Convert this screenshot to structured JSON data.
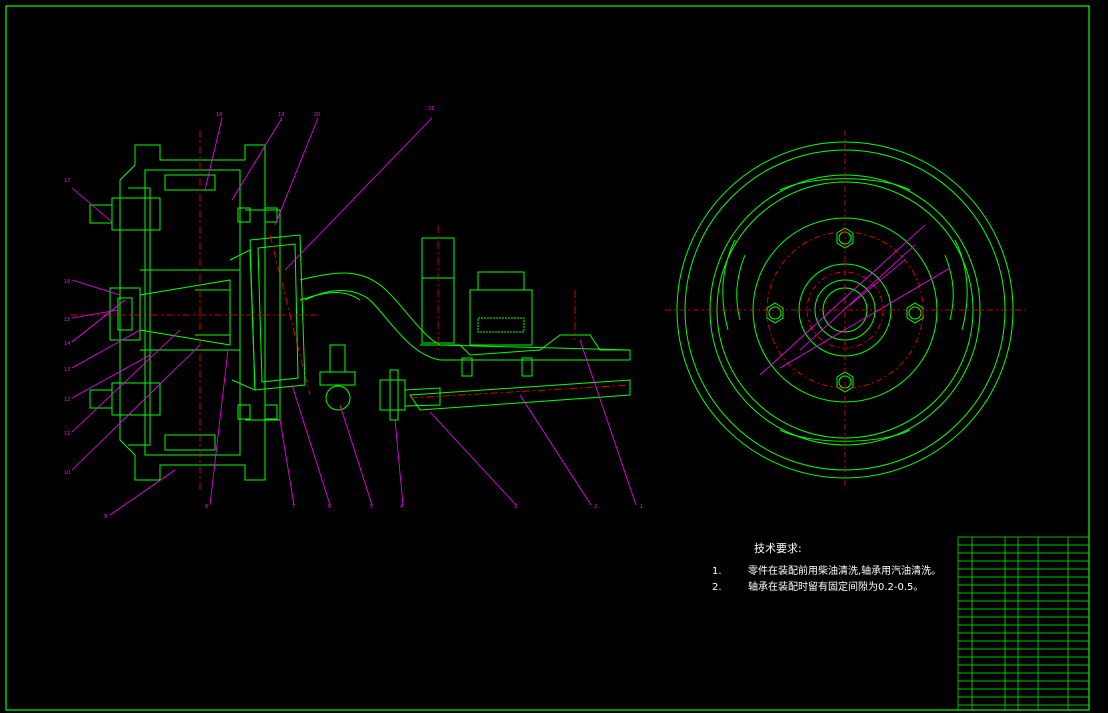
{
  "drawing": {
    "callout_numbers": [
      "1",
      "2",
      "3",
      "4",
      "5",
      "6",
      "7",
      "8",
      "9",
      "10",
      "11",
      "12",
      "13",
      "14",
      "15",
      "16",
      "17",
      "18",
      "19",
      "20",
      "21"
    ],
    "callout_color": "#ff00ff",
    "line_color": "#00ff00",
    "center_line_color": "#ff0000",
    "frame_color": "#00ff00",
    "background": "#000000"
  },
  "technical_requirements": {
    "title": "技术要求:",
    "items": [
      {
        "num": "1.",
        "text": "零件在装配前用柴油清洗,轴承用汽油清洗。"
      },
      {
        "num": "2.",
        "text": "轴承在装配时留有固定间隙为0.2-0.5。"
      }
    ]
  },
  "parts_table": {
    "header": [
      "序号",
      "名 称",
      "数量",
      "材 料",
      "备 注"
    ]
  }
}
